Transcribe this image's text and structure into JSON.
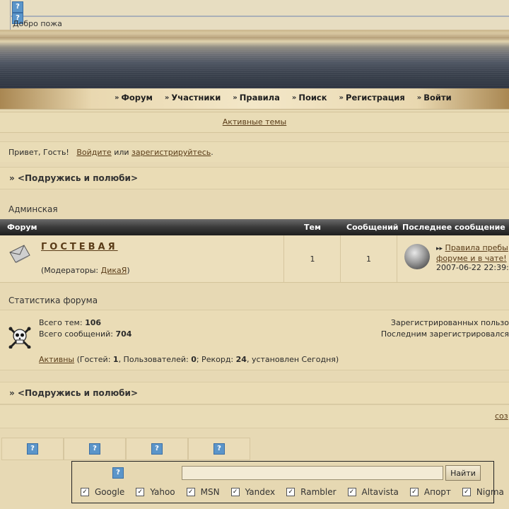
{
  "header": {
    "welcome": "Добро пожа",
    "top_icons": [
      "question-icon",
      "question-icon"
    ]
  },
  "nav": {
    "items": [
      {
        "label": "Форум"
      },
      {
        "label": "Участники"
      },
      {
        "label": "Правила"
      },
      {
        "label": "Поиск"
      },
      {
        "label": "Регистрация"
      },
      {
        "label": "Войти"
      }
    ]
  },
  "active_topics": "Активные темы",
  "greeting": {
    "hello": "Привет, Гость!",
    "login": "Войдите",
    "or": "или",
    "register": "зарегистрируйтесь",
    "end": "."
  },
  "section_title": "» <Подружись и полюби>",
  "category": "Админская",
  "table": {
    "headers": [
      "Форум",
      "Тем",
      "Сообщений",
      "Последнее сообщение"
    ],
    "rows": [
      {
        "name": "ГОСТЕВАЯ",
        "mods_prefix": "(Модераторы: ",
        "moderator": "ДикаЯ",
        "mods_suffix": ")",
        "topics": "1",
        "posts": "1",
        "last_post": "Правила пребы... форуме и в чате!",
        "last_post_line1": "Правила пребы",
        "last_post_line2": "форуме и в чате!",
        "last_date": "2007-06-22 22:39:"
      }
    ]
  },
  "stats": {
    "label": "Статистика форума",
    "topics_label": "Всего тем:",
    "topics_value": "106",
    "posts_label": "Всего сообщений:",
    "posts_value": "704",
    "registered": "Зарегистрированных пользо",
    "last_registered": "Последним зарегистрировался",
    "online": {
      "link": "Активны",
      "guests_label": " (Гостей: ",
      "guests": "1",
      "users_label": ", Пользователей: ",
      "users": "0",
      "record_label": "; Рекорд: ",
      "record": "24",
      "record_suffix": ", установлен Сегодня)"
    }
  },
  "footer": {
    "create_link": "соз"
  },
  "search": {
    "button": "Найти",
    "value": "",
    "engines": [
      "Google",
      "Yahoo",
      "MSN",
      "Yandex",
      "Rambler",
      "Altavista",
      "Апорт",
      "Nigma"
    ],
    "checked": [
      true,
      true,
      true,
      true,
      true,
      true,
      true,
      true
    ]
  },
  "colors": {
    "link": "#5a3c18",
    "panel": "#eadcb6",
    "header_dark": "#1e1e1e"
  }
}
